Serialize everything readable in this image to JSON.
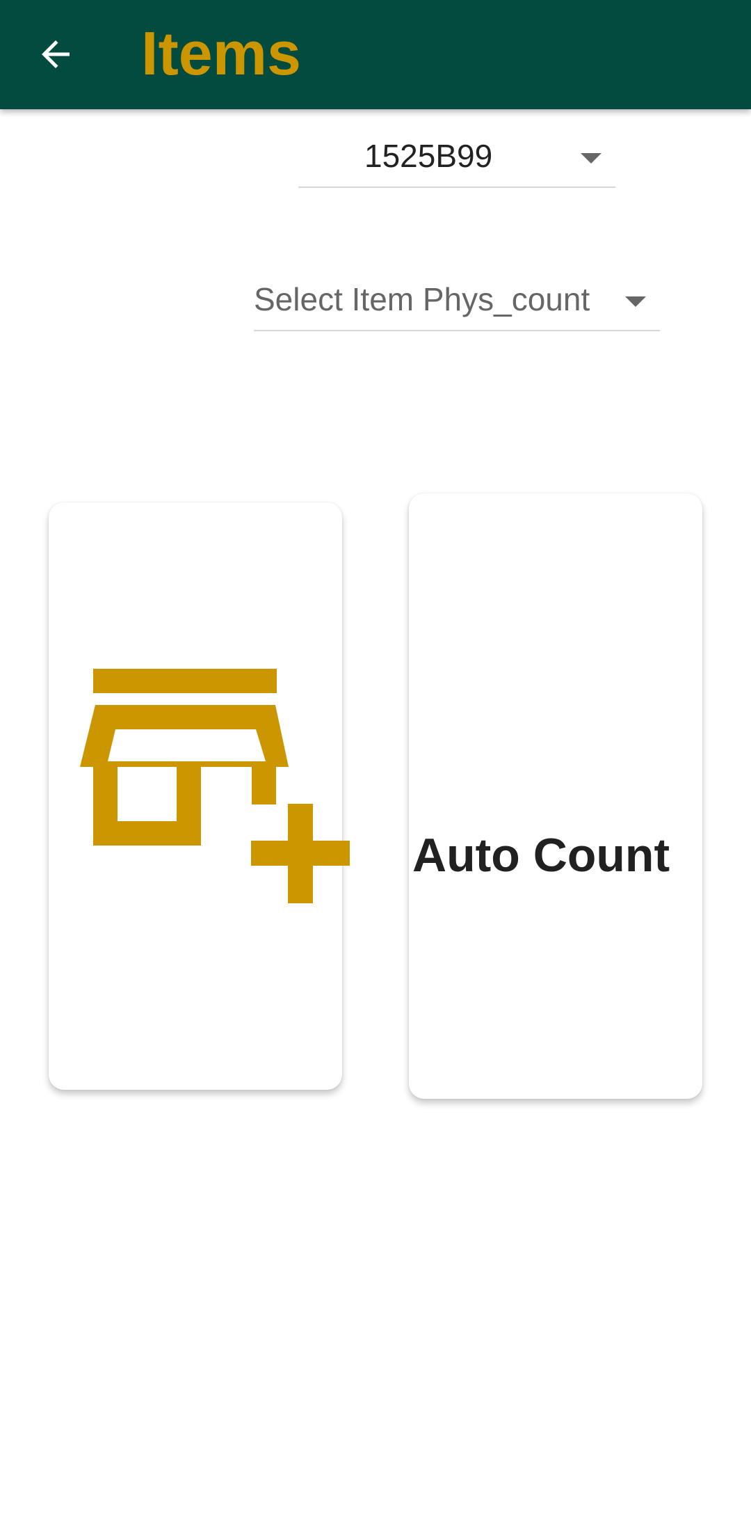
{
  "app_bar": {
    "title": "Items",
    "title_color": "#cc9600",
    "background_color": "#024b3e",
    "back_icon": "arrow-back-icon"
  },
  "site_dropdown": {
    "value": "1525B99",
    "arrow_icon": "dropdown-arrow-icon"
  },
  "item_dropdown": {
    "placeholder": "Select Item Phys_count",
    "arrow_icon": "dropdown-arrow-icon"
  },
  "cards": {
    "add_store": {
      "icon": "add-business-icon",
      "icon_color": "#cc9600"
    },
    "auto_count": {
      "label": "Auto Count"
    }
  }
}
